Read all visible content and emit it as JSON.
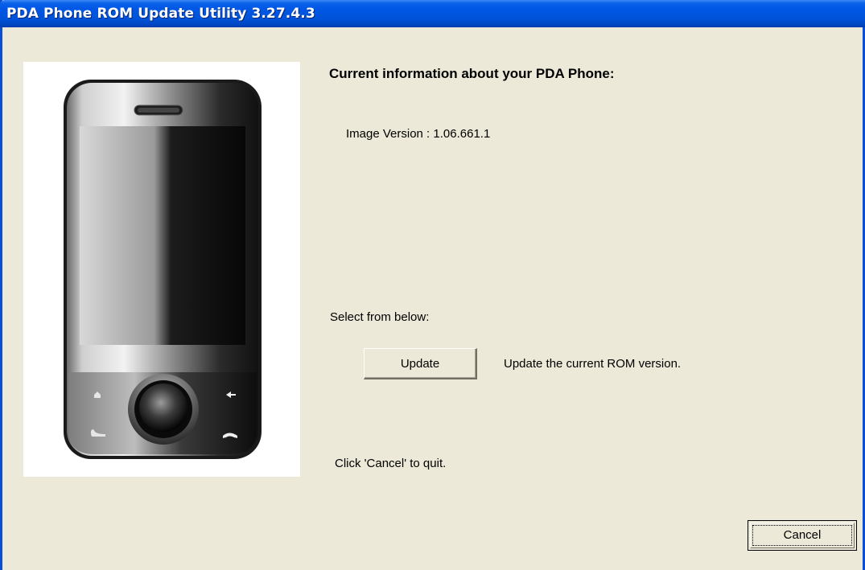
{
  "window": {
    "title": "PDA Phone ROM Update Utility 3.27.4.3"
  },
  "main": {
    "heading": "Current information about your PDA Phone:",
    "image_version": "Image Version : 1.06.661.1",
    "select_label": "Select from below:",
    "update_button": "Update",
    "update_description": "Update the current ROM version.",
    "cancel_hint": "Click 'Cancel' to quit.",
    "cancel_button": "Cancel"
  },
  "icons": {
    "device": "pda-phone-illustration",
    "phone_buttons": [
      "home-icon",
      "back-arrow-icon",
      "call-icon",
      "end-call-icon"
    ]
  },
  "colors": {
    "title_bar": "#0058e6",
    "dialog_background": "#ece9d8",
    "title_text": "#ffffff"
  }
}
